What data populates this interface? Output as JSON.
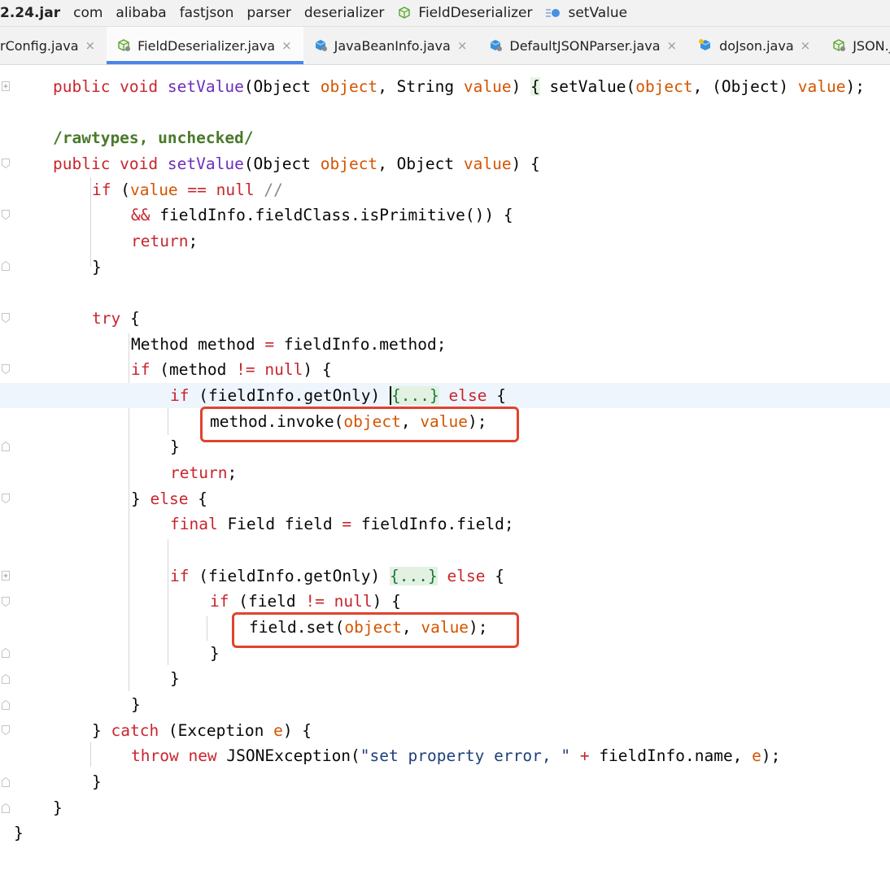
{
  "breadcrumb": {
    "items": [
      "2.24.jar",
      "com",
      "alibaba",
      "fastjson",
      "parser",
      "deserializer",
      "FieldDeserializer",
      "setValue"
    ],
    "icons": [
      "",
      "",
      "",
      "",
      "",
      "",
      "class-icon",
      "method-icon"
    ]
  },
  "tabs": [
    {
      "label": "rConfig.java",
      "icon": "",
      "active": false
    },
    {
      "label": "FieldDeserializer.java",
      "icon": "class-icon",
      "active": true
    },
    {
      "label": "JavaBeanInfo.java",
      "icon": "java-file-icon",
      "active": false
    },
    {
      "label": "DefaultJSONParser.java",
      "icon": "java-file-icon",
      "active": false
    },
    {
      "label": "doJson.java",
      "icon": "java-file-icon",
      "active": false
    },
    {
      "label": "JSON.j",
      "icon": "class-icon",
      "active": false
    }
  ],
  "tab_close_glyph": "×",
  "code": {
    "l1": {
      "a": "public void ",
      "b": "setValue",
      "c": "(Object ",
      "d": "object",
      "e": ", String ",
      "f": "value",
      "g": ") ",
      "h": "{",
      "i": " setValue(",
      "j": "object",
      "k": ", (Object) ",
      "l": "value",
      "m": ");"
    },
    "l2": {
      "a": "/rawtypes, unchecked/"
    },
    "l3": {
      "a": "public void ",
      "b": "setValue",
      "c": "(Object ",
      "d": "object",
      "e": ", Object ",
      "f": "value",
      "g": ") {"
    },
    "l4": {
      "a": "if",
      "b": " (",
      "c": "value",
      "d": " ",
      "e": "==",
      "f": " ",
      "g": "null",
      "h": " //"
    },
    "l5": {
      "a": "&&",
      "b": " fieldInfo.fieldClass.isPrimitive()) {"
    },
    "l6": {
      "a": "return",
      "b": ";"
    },
    "l7": {
      "a": "}"
    },
    "l8": {
      "a": "try",
      "b": " {"
    },
    "l9": {
      "a": "Method method ",
      "b": "=",
      "c": " fieldInfo.method;"
    },
    "l10": {
      "a": "if",
      "b": " (method ",
      "c": "!=",
      "d": " ",
      "e": "null",
      "f": ") {"
    },
    "l11": {
      "a": "if",
      "b": " (fieldInfo.getOnly) ",
      "c": "{...}",
      "d": " ",
      "e": "else",
      "f": " {"
    },
    "l12": {
      "a": "method.invoke(",
      "b": "object",
      "c": ", ",
      "d": "value",
      "e": ");"
    },
    "l13": {
      "a": "}"
    },
    "l14": {
      "a": "return",
      "b": ";"
    },
    "l15": {
      "a": "} ",
      "b": "else",
      "c": " {"
    },
    "l16": {
      "a": "final",
      "b": " Field field ",
      "c": "=",
      "d": " fieldInfo.field;"
    },
    "l17": {
      "a": "if",
      "b": " (fieldInfo.getOnly) ",
      "c": "{...}",
      "d": " ",
      "e": "else",
      "f": " {"
    },
    "l18": {
      "a": "if",
      "b": " (field ",
      "c": "!=",
      "d": " ",
      "e": "null",
      "f": ") {"
    },
    "l19": {
      "a": "field.set(",
      "b": "object",
      "c": ", ",
      "d": "value",
      "e": ");"
    },
    "l20": {
      "a": "}"
    },
    "l21": {
      "a": "}"
    },
    "l22": {
      "a": "}"
    },
    "l23": {
      "a": "} ",
      "b": "catch",
      "c": " (Exception ",
      "d": "e",
      "e": ") {"
    },
    "l24": {
      "a": "throw",
      "b": " ",
      "c": "new",
      "d": " JSONException(",
      "e": "\"set property error, \"",
      "f": " ",
      "g": "+",
      "h": " fieldInfo.name, ",
      "i": "e",
      "j": ");"
    },
    "l25": {
      "a": "}"
    },
    "l26": {
      "a": "}"
    },
    "l27": {
      "a": "}"
    }
  },
  "colors": {
    "keyword": "#c9252d",
    "method": "#6b2fba",
    "parameter": "#d35400",
    "annotation": "#4a7a2a",
    "string": "#1f3f7a",
    "highlight_box": "#e0432f",
    "active_tab_underline": "#4a86e8",
    "current_line": "#eef5fd"
  }
}
